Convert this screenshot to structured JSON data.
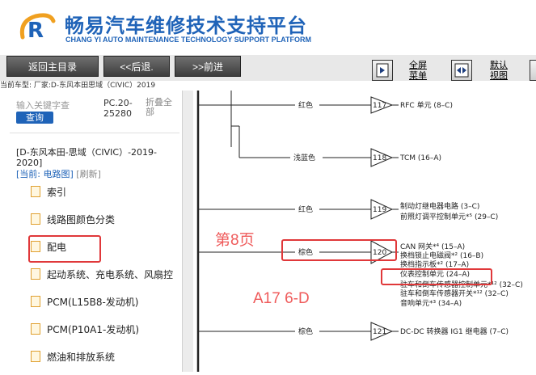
{
  "header": {
    "title_cn": "畅易汽车维修技术支持平台",
    "title_en": "CHANG YI AUTO MAINTENANCE TECHNOLOGY SUPPORT PLATFORM"
  },
  "toolbar": {
    "back_main": "返回主目录",
    "back": "<<后退.",
    "forward": ">>前进",
    "fullscreen_l1": "全屏",
    "fullscreen_l2": "菜单",
    "default_l1": "默认",
    "default_l2": "视图"
  },
  "car_info": "当前车型: 厂家:D-东风本田思域（CIVIC）2019",
  "sidebar": {
    "search_placeholder": "输入关键字查",
    "search_button": "查询",
    "code_l1": "PC.20-",
    "code_l2": "25280",
    "fold_l1": "折叠全",
    "fold_l2": "部",
    "car_desc_l1": "[D-东风本田-思域（CIVIC）-2019-",
    "car_desc_l2": "2020]",
    "current_label": "[当前: 电路图]",
    "refresh": "[刷新]",
    "items": [
      "索引",
      "线路图颜色分类",
      "配电",
      "起动系统、充电系统、风扇控",
      "PCM(L15B8-发动机)",
      "PCM(P10A1-发动机)",
      "燃油和排放系统"
    ]
  },
  "diagram": {
    "page_annotation": "第8页",
    "ref_annotation": "A17 6-D",
    "wires": [
      {
        "color": "红色",
        "num": "117",
        "targets": [
          "RFC 单元 (8–C)"
        ]
      },
      {
        "color": "浅蓝色",
        "num": "118",
        "targets": [
          "TCM (16–A)"
        ]
      },
      {
        "color": "红色",
        "num": "119",
        "targets": [
          "制动灯继电器电路 (3–C)",
          "前照灯调平控制单元*⁵ (29–C)"
        ]
      },
      {
        "color": "棕色",
        "num": "120",
        "targets": [
          "CAN 网关*⁴ (15–A)",
          "换档锁止电磁阀*² (16–B)",
          "换档指示板*² (17–A)",
          "仪表控制单元 (24–A)",
          "驻车和倒车传感器控制单元*¹² (32–C)",
          "驻车和倒车传感器开关*¹² (32–C)",
          "音响单元*³ (34–A)"
        ]
      },
      {
        "color": "棕色",
        "num": "121",
        "targets": [
          "DC-DC 转换器 IG1 继电器 (7–C)"
        ]
      }
    ]
  }
}
